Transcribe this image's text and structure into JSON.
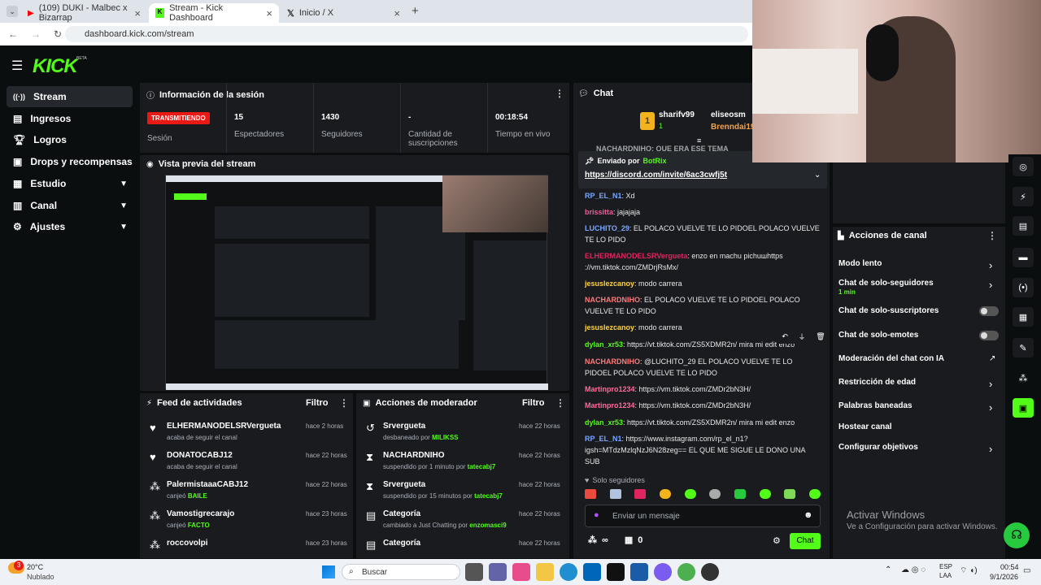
{
  "browser": {
    "tabs": [
      {
        "title": "(109) DUKI - Malbec x Bizarrap"
      },
      {
        "title": "Stream - Kick Dashboard"
      },
      {
        "title": "Inicio / X"
      }
    ],
    "url": "dashboard.kick.com/stream"
  },
  "logo": {
    "text": "KICK",
    "badge": "BETA"
  },
  "sidebar": {
    "items": [
      {
        "label": "Stream"
      },
      {
        "label": "Ingresos"
      },
      {
        "label": "Logros"
      },
      {
        "label": "Drops y recompensas"
      },
      {
        "label": "Estudio"
      },
      {
        "label": "Canal"
      },
      {
        "label": "Ajustes"
      }
    ]
  },
  "session": {
    "title": "Información de la sesión",
    "status_badge": "TRANSMITIENDO",
    "status_label": "Sesión",
    "stats": [
      {
        "value": "15",
        "label": "Espectadores"
      },
      {
        "value": "1430",
        "label": "Seguidores"
      },
      {
        "value": "-",
        "label": "Cantidad de suscripciones"
      },
      {
        "value": "00:18:54",
        "label": "Tiempo en vivo"
      }
    ]
  },
  "preview": {
    "title": "Vista previa del stream"
  },
  "activity": {
    "title": "Feed de actividades",
    "filter": "Filtro",
    "items": [
      {
        "user": "ELHERMANODELSRVergueta",
        "time": "hace 2 horas",
        "desc": "acaba de seguir el canal",
        "extra": ""
      },
      {
        "user": "DONATOCABJ12",
        "time": "hace 22 horas",
        "desc": "acaba de seguir el canal",
        "extra": ""
      },
      {
        "user": "PalermistaaaCABJ12",
        "time": "hace 22 horas",
        "desc": "canjeó",
        "extra": "BAILE"
      },
      {
        "user": "Vamostigrecarajo",
        "time": "hace 23 horas",
        "desc": "canjeó",
        "extra": "FACTO"
      },
      {
        "user": "roccovolpi",
        "time": "hace 23 horas",
        "desc": "",
        "extra": ""
      }
    ]
  },
  "mod": {
    "title": "Acciones de moderador",
    "filter": "Filtro",
    "items": [
      {
        "user": "Srvergueta",
        "time": "hace 22 horas",
        "desc": "desbaneado por",
        "by": "MILIKSS"
      },
      {
        "user": "NACHARDNIHO",
        "time": "hace 22 horas",
        "desc": "suspendido por 1 minuto por",
        "by": "tatecabj7"
      },
      {
        "user": "Srvergueta",
        "time": "hace 22 horas",
        "desc": "suspendido por 15 minutos por",
        "by": "tatecabj7"
      },
      {
        "user": "Categoría",
        "time": "hace 22 horas",
        "desc": "cambiado a Just Chatting por",
        "by": "enzomasci9"
      },
      {
        "user": "Categoría",
        "time": "hace 22 horas",
        "desc": "",
        "by": ""
      }
    ]
  },
  "chat": {
    "title": "Chat",
    "leaders": [
      {
        "rank": "1",
        "name": "sharifv99",
        "count": "1"
      },
      {
        "name": "eliseosm"
      },
      {
        "name": "Brenndai19"
      }
    ],
    "partial_top": "NACHARDNIHO: QUE ERA ESE TEMA",
    "pinned": {
      "label": "Enviado por",
      "user": "BotRix",
      "link": "https://discord.com/invite/6ac3cwfj5t"
    },
    "messages": [
      {
        "user": "RP_EL_N1",
        "color": "#7aa7ff",
        "text": "Xd"
      },
      {
        "user": "brissitta",
        "color": "#f25c9a",
        "text": "jajajaja"
      },
      {
        "user": "LUCHITO_29",
        "color": "#7aa7ff",
        "text": "EL POLACO VUELVE TE LO PIDOEL POLACO VUELVE TE LO PIDO"
      },
      {
        "user": "ELHERMANODELSRVergueta",
        "color": "#e0245e",
        "text": "enzo en machu pichuшhttps ://vm.tiktok.com/ZMDrjRsMx/"
      },
      {
        "user": "jesuslezcanoy",
        "color": "#ffd23f",
        "text": "modo carrera"
      },
      {
        "user": "NACHARDNIHO",
        "color": "#ff7a7a",
        "text": "EL POLACO VUELVE TE LO PIDOEL POLACO VUELVE TE LO PIDO"
      },
      {
        "user": "jesuslezcanoy",
        "color": "#ffd23f",
        "text": "modo carrera"
      },
      {
        "user": "dylan_xr53",
        "color": "#53fc18",
        "text": "https://vt.tiktok.com/ZS5XDMR2n/ mira mi edit enzo"
      },
      {
        "user": "NACHARDNIHO",
        "color": "#ff7a7a",
        "text": "@LUCHITO_29 EL POLACO VUELVE TE LO PIDOEL POLACO VUELVE TE LO PIDO"
      },
      {
        "user": "Martinpro1234",
        "color": "#ff6b9a",
        "text": "https://vm.tiktok.com/ZMDr2bN3H/"
      },
      {
        "user": "Martinpro1234",
        "color": "#ff6b9a",
        "text": "https://vm.tiktok.com/ZMDr2bN3H/"
      },
      {
        "user": "dylan_xr53",
        "color": "#53fc18",
        "text": "https://vt.tiktok.com/ZS5XDMR2n/ mira mi edit enzo"
      },
      {
        "user": "RP_EL_N1",
        "color": "#7aa7ff",
        "text": "https://www.instagram.com/rp_el_n1?igsh=MTdzMzlqNzJ6N28zeg== EL QUE ME SIGUE LE DONO UNA SUB"
      }
    ],
    "mode_label": "Solo seguidores",
    "input_placeholder": "Enviar un mensaje",
    "points": "∞",
    "gifts": "0",
    "send_label": "Chat"
  },
  "channel_actions": {
    "title": "Acciones de canal",
    "items": [
      {
        "label": "Modo lento",
        "sub": ""
      },
      {
        "label": "Chat de solo-seguidores",
        "sub": "1 min"
      },
      {
        "label": "Chat de solo-suscriptores",
        "sub": ""
      },
      {
        "label": "Chat de solo-emotes",
        "sub": ""
      },
      {
        "label": "Moderación del chat con IA",
        "sub": ""
      },
      {
        "label": "Restricción de edad",
        "sub": ""
      },
      {
        "label": "Palabras baneadas",
        "sub": ""
      },
      {
        "label": "Hostear canal",
        "sub": ""
      },
      {
        "label": "Configurar objetivos",
        "sub": ""
      }
    ]
  },
  "windows_activation": {
    "title": "Activar Windows",
    "subtitle": "Ve a Configuración para activar Windows."
  },
  "taskbar": {
    "weather_temp": "20°C",
    "weather_desc": "Nublado",
    "search": "Buscar",
    "lang": "ESP",
    "lang2": "LAA",
    "time": "00:54",
    "date": "9/1/2026",
    "badge": "3"
  },
  "colors": {
    "accent": "#53fc18",
    "badge_red": "#e91916",
    "panel": "#191b1f"
  }
}
